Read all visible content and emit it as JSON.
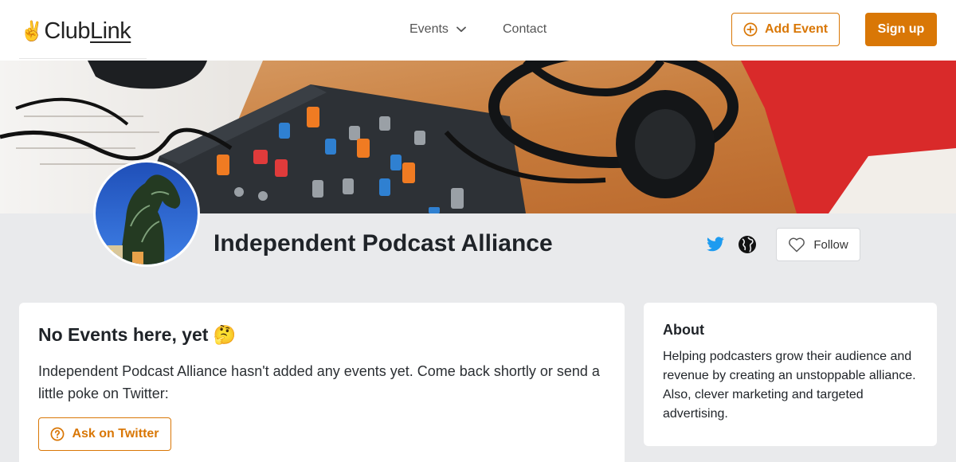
{
  "header": {
    "logo": {
      "hand": "✌️",
      "club": "Club",
      "link": "Link"
    },
    "nav": {
      "events_label": "Events",
      "contact_label": "Contact"
    },
    "add_event_label": "Add Event",
    "signup_label": "Sign up"
  },
  "club": {
    "name": "Independent Podcast Alliance",
    "follow_label": "Follow"
  },
  "events_card": {
    "heading": "No Events here, yet 🤔",
    "body": "Independent Podcast Alliance hasn't added any events yet. Come back shortly or send a little poke on Twitter:",
    "ask_button_label": "Ask on Twitter"
  },
  "about_card": {
    "heading": "About",
    "body": "Helping podcasters grow their audience and revenue by creating an unstoppable alliance. Also, clever marketing and targeted advertising."
  },
  "icons": {
    "add": "plus-circle-icon",
    "events_dropdown": "chevron-down-icon",
    "twitter": "twitter-icon",
    "website": "globe-icon",
    "follow": "heart-icon",
    "ask": "question-circle-icon"
  },
  "colors": {
    "accent": "#d97706",
    "twitter": "#1d9bf0",
    "background": "#e9eaec"
  }
}
